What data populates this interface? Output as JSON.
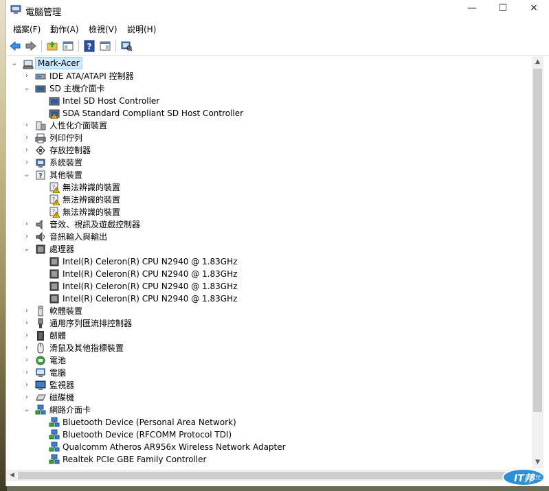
{
  "window": {
    "title": "電腦管理",
    "min_glyph": "—",
    "max_glyph": "☐",
    "close_glyph": "✕"
  },
  "menu": [
    "檔案(F)",
    "動作(A)",
    "檢視(V)",
    "說明(H)"
  ],
  "toolbar": {
    "icons": [
      "back-arrow-icon",
      "forward-arrow-icon",
      "up-folder-icon",
      "show-hide-tree-icon",
      "help-icon",
      "properties-icon",
      "scan-hardware-icon"
    ]
  },
  "tree": {
    "root": "Mark-Acer",
    "nodes": [
      {
        "label": "IDE ATA/ATAPI 控制器",
        "level": 1,
        "expander": "closed",
        "icon": "ide-controller-icon"
      },
      {
        "label": "SD 主機介面卡",
        "level": 1,
        "expander": "open",
        "icon": "sd-host-icon"
      },
      {
        "label": "Intel SD Host Controller",
        "level": 2,
        "expander": "none",
        "icon": "sd-card-icon"
      },
      {
        "label": "SDA Standard Compliant SD Host Controller",
        "level": 2,
        "expander": "none",
        "icon": "sd-card-warning-icon"
      },
      {
        "label": "人性化介面裝置",
        "level": 1,
        "expander": "closed",
        "icon": "hid-icon"
      },
      {
        "label": "列印佇列",
        "level": 1,
        "expander": "closed",
        "icon": "printer-icon"
      },
      {
        "label": "存放控制器",
        "level": 1,
        "expander": "closed",
        "icon": "storage-controller-icon"
      },
      {
        "label": "系統裝置",
        "level": 1,
        "expander": "closed",
        "icon": "system-device-icon"
      },
      {
        "label": "其他裝置",
        "level": 1,
        "expander": "open",
        "icon": "other-devices-icon"
      },
      {
        "label": "無法辨識的裝置",
        "level": 2,
        "expander": "none",
        "icon": "unknown-device-warning-icon"
      },
      {
        "label": "無法辨識的裝置",
        "level": 2,
        "expander": "none",
        "icon": "unknown-device-warning-icon"
      },
      {
        "label": "無法辨識的裝置",
        "level": 2,
        "expander": "none",
        "icon": "unknown-device-warning-icon"
      },
      {
        "label": "音效、視訊及遊戲控制器",
        "level": 1,
        "expander": "closed",
        "icon": "speaker-icon"
      },
      {
        "label": "音訊輸入與輸出",
        "level": 1,
        "expander": "closed",
        "icon": "audio-io-icon"
      },
      {
        "label": "處理器",
        "level": 1,
        "expander": "open",
        "icon": "processor-icon"
      },
      {
        "label": "Intel(R) Celeron(R) CPU  N2940  @ 1.83GHz",
        "level": 2,
        "expander": "none",
        "icon": "cpu-icon"
      },
      {
        "label": "Intel(R) Celeron(R) CPU  N2940  @ 1.83GHz",
        "level": 2,
        "expander": "none",
        "icon": "cpu-icon"
      },
      {
        "label": "Intel(R) Celeron(R) CPU  N2940  @ 1.83GHz",
        "level": 2,
        "expander": "none",
        "icon": "cpu-icon"
      },
      {
        "label": "Intel(R) Celeron(R) CPU  N2940  @ 1.83GHz",
        "level": 2,
        "expander": "none",
        "icon": "cpu-icon"
      },
      {
        "label": "軟體裝置",
        "level": 1,
        "expander": "closed",
        "icon": "software-device-icon"
      },
      {
        "label": "通用序列匯流排控制器",
        "level": 1,
        "expander": "closed",
        "icon": "usb-icon"
      },
      {
        "label": "韌體",
        "level": 1,
        "expander": "closed",
        "icon": "firmware-icon"
      },
      {
        "label": "滑鼠及其他指標裝置",
        "level": 1,
        "expander": "closed",
        "icon": "mouse-icon"
      },
      {
        "label": "電池",
        "level": 1,
        "expander": "closed",
        "icon": "battery-icon"
      },
      {
        "label": "電腦",
        "level": 1,
        "expander": "closed",
        "icon": "computer-icon"
      },
      {
        "label": "監視器",
        "level": 1,
        "expander": "closed",
        "icon": "monitor-icon"
      },
      {
        "label": "磁碟機",
        "level": 1,
        "expander": "closed",
        "icon": "disk-drive-icon"
      },
      {
        "label": "網路介面卡",
        "level": 1,
        "expander": "open",
        "icon": "network-adapter-icon"
      },
      {
        "label": "Bluetooth Device (Personal Area Network)",
        "level": 2,
        "expander": "none",
        "icon": "network-adapter-icon"
      },
      {
        "label": "Bluetooth Device (RFCOMM Protocol TDI)",
        "level": 2,
        "expander": "none",
        "icon": "network-adapter-icon"
      },
      {
        "label": "Qualcomm Atheros AR956x Wireless Network Adapter",
        "level": 2,
        "expander": "none",
        "icon": "network-adapter-icon"
      },
      {
        "label": "Realtek PCIe GBE Family Controller",
        "level": 2,
        "expander": "none",
        "icon": "network-adapter-icon"
      }
    ]
  },
  "watermark": {
    "main": "IT邦",
    "sub": "幫忙"
  },
  "colors": {
    "selection": "#cce8ff",
    "warning": "#f2c200",
    "scrollbar": "#cdcdcd"
  }
}
